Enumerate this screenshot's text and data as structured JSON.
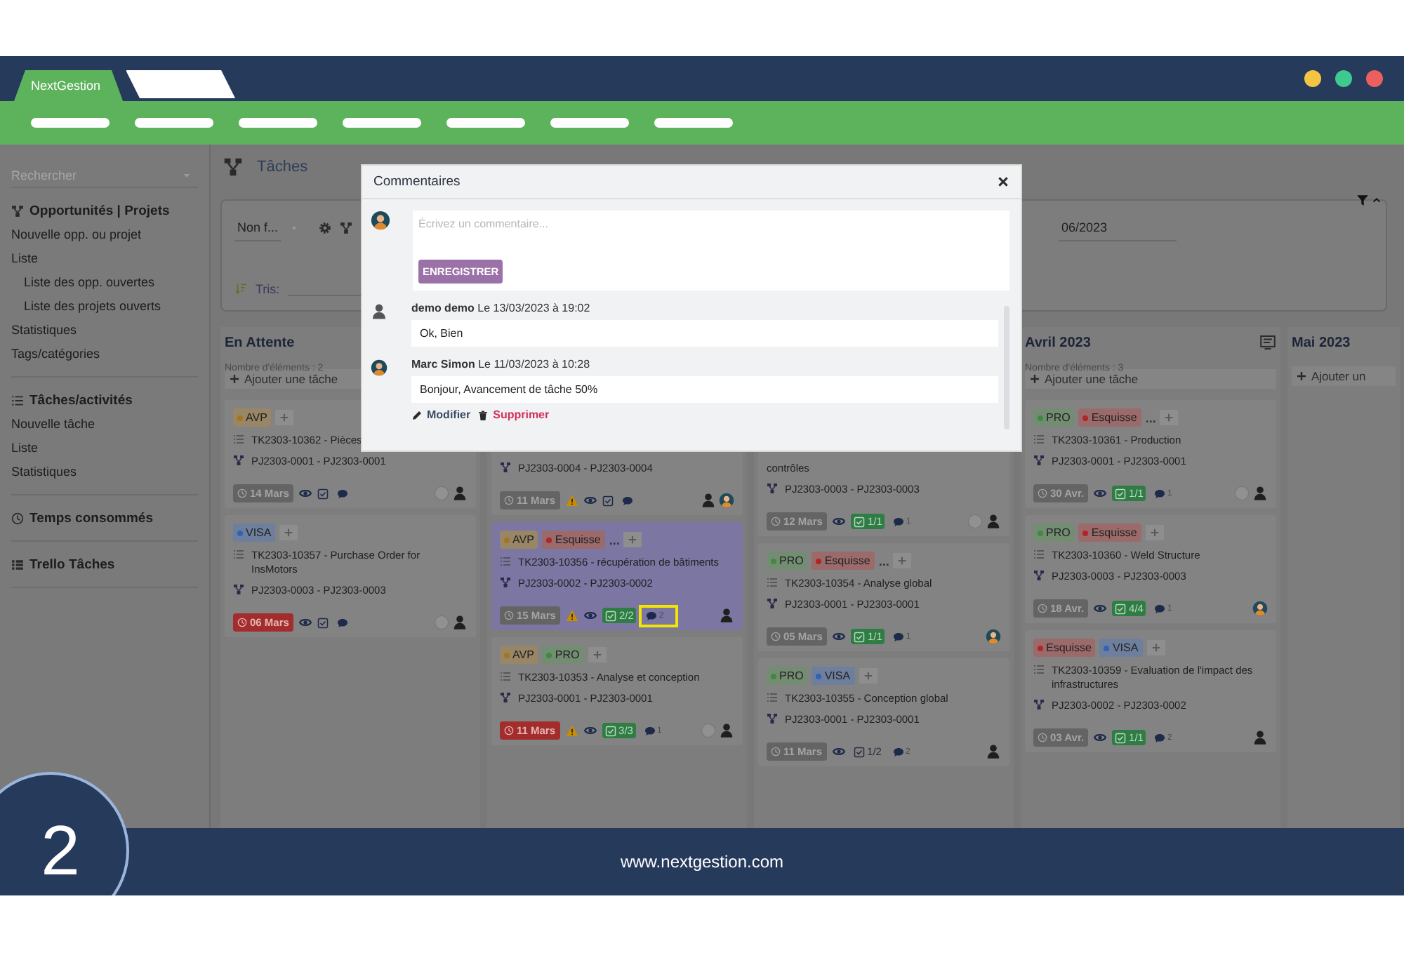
{
  "browser": {
    "tabs": [
      {
        "label": "NextGestion"
      }
    ]
  },
  "sidebar": {
    "search_placeholder": "Rechercher",
    "sections": [
      {
        "title": "Opportunités | Projets",
        "kind": "network",
        "items": [
          {
            "label": "Nouvelle opp. ou projet"
          },
          {
            "label": "Liste",
            "children": [
              {
                "label": "Liste des opp. ouvertes"
              },
              {
                "label": "Liste des projets ouverts"
              }
            ]
          },
          {
            "label": "Statistiques"
          },
          {
            "label": "Tags/catégories"
          }
        ]
      },
      {
        "title": "Tâches/activités",
        "kind": "tasks",
        "items": [
          {
            "label": "Nouvelle tâche"
          },
          {
            "label": "Liste"
          },
          {
            "label": "Statistiques"
          }
        ]
      },
      {
        "title": "Temps consommés",
        "kind": "clock"
      },
      {
        "title": "Trello Tâches",
        "kind": "board"
      }
    ]
  },
  "page": {
    "title": "Tâches"
  },
  "filters": {
    "status_select": "Non f...",
    "sort_label": "Tris:",
    "date_value": "06/2023"
  },
  "columns": [
    {
      "title": "En Attente",
      "count": "Nombre d'éléments : 2",
      "add_label": "Ajouter une tâche",
      "cards": [
        {
          "tags": [
            {
              "label": "AVP",
              "color": "#a8741c"
            }
          ],
          "title": "TK2303-10362 - Pièces",
          "project": "PJ2303-0001 - PJ2303-0001",
          "date": {
            "text": "14 Mars",
            "late": false
          },
          "avatars": [
            {
              "kind": "empty"
            },
            {
              "kind": "user"
            }
          ]
        },
        {
          "tags": [
            {
              "label": "VISA",
              "color": "#2f62b8"
            }
          ],
          "title": "TK2303-10357 - Purchase Order for InsMotors",
          "project": "PJ2303-0003 - PJ2303-0003",
          "date": {
            "text": "06 Mars",
            "late": true
          },
          "avatars": [
            {
              "kind": "empty"
            },
            {
              "kind": "user"
            }
          ]
        }
      ]
    },
    {
      "cards": [
        {
          "project": "PJ2303-0004 - PJ2303-0004",
          "date": {
            "text": "11 Mars",
            "late": false
          },
          "warning": true,
          "avatars": [
            {
              "kind": "user"
            },
            {
              "kind": "photo"
            }
          ]
        },
        {
          "highlighted": true,
          "tags": [
            {
              "label": "AVP",
              "color": "#a8741c"
            },
            {
              "label": "Esquisse",
              "color": "#b02525"
            }
          ],
          "more": "...",
          "title": "TK2303-10356 - récupération de bâtiments",
          "project": "PJ2303-0002 - PJ2303-0002",
          "date": {
            "text": "15 Mars",
            "late": false
          },
          "warning": true,
          "checklist": {
            "text": "2/2",
            "complete": true
          },
          "comments": "2",
          "comment_highlight": true,
          "avatars": [
            {
              "kind": "user"
            }
          ]
        },
        {
          "tags": [
            {
              "label": "AVP",
              "color": "#a8741c"
            },
            {
              "label": "PRO",
              "color": "#3f8a3f"
            }
          ],
          "title": "TK2303-10353 - Analyse et conception",
          "project": "PJ2303-0001 - PJ2303-0001",
          "date": {
            "text": "11 Mars",
            "late": true
          },
          "warning": true,
          "checklist": {
            "text": "3/3",
            "complete": true
          },
          "comments": "1",
          "avatars": [
            {
              "kind": "empty"
            },
            {
              "kind": "user"
            }
          ]
        }
      ]
    },
    {
      "cards": [
        {
          "title": "contrôles",
          "project": "PJ2303-0003 - PJ2303-0003",
          "date": {
            "text": "12 Mars",
            "late": false
          },
          "checklist": {
            "text": "1/1",
            "complete": true
          },
          "comments": "1",
          "avatars": [
            {
              "kind": "empty"
            },
            {
              "kind": "user"
            }
          ]
        },
        {
          "tags": [
            {
              "label": "PRO",
              "color": "#3f8a3f"
            },
            {
              "label": "Esquisse",
              "color": "#b02525"
            }
          ],
          "more": "...",
          "title": "TK2303-10354 - Analyse global",
          "project": "PJ2303-0001 - PJ2303-0001",
          "date": {
            "text": "05 Mars",
            "late": false
          },
          "checklist": {
            "text": "1/1",
            "complete": true
          },
          "comments": "1",
          "avatars": [
            {
              "kind": "photo"
            }
          ]
        },
        {
          "tags": [
            {
              "label": "PRO",
              "color": "#3f8a3f"
            },
            {
              "label": "VISA",
              "color": "#2f62b8"
            }
          ],
          "title": "TK2303-10355 - Conception global",
          "project": "PJ2303-0001 - PJ2303-0001",
          "date": {
            "text": "11 Mars",
            "late": false
          },
          "checklist": {
            "text": "1/2",
            "complete": false
          },
          "comments": "2",
          "avatars": [
            {
              "kind": "user"
            }
          ]
        }
      ]
    },
    {
      "title": "Avril 2023",
      "view_icon": true,
      "count": "Nombre d'éléments : 3",
      "add_label": "Ajouter une tâche",
      "cards": [
        {
          "tags": [
            {
              "label": "PRO",
              "color": "#3f8a3f"
            },
            {
              "label": "Esquisse",
              "color": "#b02525"
            }
          ],
          "more": "...",
          "title": "TK2303-10361 - Production",
          "project": "PJ2303-0001 - PJ2303-0001",
          "date": {
            "text": "30 Avr.",
            "late": false
          },
          "checklist": {
            "text": "1/1",
            "complete": true
          },
          "comments": "1",
          "avatars": [
            {
              "kind": "empty"
            },
            {
              "kind": "user"
            }
          ]
        },
        {
          "tags": [
            {
              "label": "PRO",
              "color": "#3f8a3f"
            },
            {
              "label": "Esquisse",
              "color": "#b02525"
            }
          ],
          "title": "TK2303-10360 - Weld Structure",
          "project": "PJ2303-0003 - PJ2303-0003",
          "date": {
            "text": "18 Avr.",
            "late": false
          },
          "checklist": {
            "text": "4/4",
            "complete": true
          },
          "comments": "1",
          "avatars": [
            {
              "kind": "photo"
            }
          ]
        },
        {
          "tags": [
            {
              "label": "Esquisse",
              "color": "#b02525"
            },
            {
              "label": "VISA",
              "color": "#2f62b8"
            }
          ],
          "title": "TK2303-10359 - Evaluation de l'impact des infrastructures",
          "project": "PJ2303-0002 - PJ2303-0002",
          "date": {
            "text": "03 Avr.",
            "late": false
          },
          "checklist": {
            "text": "1/1",
            "complete": true
          },
          "comments": "2",
          "avatars": [
            {
              "kind": "user"
            }
          ]
        }
      ]
    },
    {
      "title": "Mai 2023",
      "add_label": "Ajouter un"
    }
  ],
  "modal": {
    "title": "Commentaires",
    "placeholder": "Écrivez un commentaire...",
    "save_label": "ENREGISTRER",
    "comments": [
      {
        "kind": "user",
        "header": "**demo demo** Le 13/03/2023 à 19:02",
        "text": "Ok, Bien"
      },
      {
        "kind": "photo",
        "header": "**Marc Simon** Le 11/03/2023 à 10:28",
        "text": "Bonjour, Avancement de tâche 50%",
        "edit_label": "Modifier",
        "delete_label": "Supprimer"
      }
    ]
  },
  "footer": {
    "url": "www.nextgestion.com"
  },
  "step": "2"
}
